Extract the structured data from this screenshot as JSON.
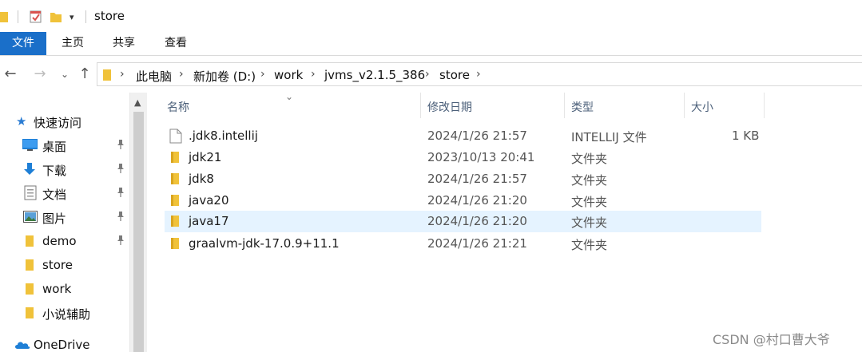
{
  "window": {
    "title": "store"
  },
  "quick_access_toolbar": {
    "icons": [
      "folder-icon",
      "properties-check-icon",
      "new-folder-icon",
      "customize-dropdown-icon"
    ]
  },
  "ribbon": {
    "tabs": [
      "文件",
      "主页",
      "共享",
      "查看"
    ],
    "active": "文件",
    "accent": "#1a6fc9"
  },
  "address_bar": {
    "breadcrumbs": [
      "此电脑",
      "新加卷 (D:)",
      "work",
      "jvms_v2.1.5_386",
      "store"
    ]
  },
  "nav_pane": {
    "quick_access_label": "快速访问",
    "items": [
      {
        "label": "桌面",
        "icon": "desktop-icon",
        "pinned": true
      },
      {
        "label": "下载",
        "icon": "download-icon",
        "pinned": true
      },
      {
        "label": "文档",
        "icon": "documents-icon",
        "pinned": true
      },
      {
        "label": "图片",
        "icon": "pictures-icon",
        "pinned": true
      },
      {
        "label": "demo",
        "icon": "folder-icon",
        "pinned": true
      },
      {
        "label": "store",
        "icon": "folder-icon",
        "pinned": false
      },
      {
        "label": "work",
        "icon": "folder-icon",
        "pinned": false
      },
      {
        "label": "小说辅助",
        "icon": "folder-icon",
        "pinned": false
      }
    ],
    "onedrive_label": "OneDrive"
  },
  "file_list": {
    "columns": {
      "name": "名称",
      "modified": "修改日期",
      "type": "类型",
      "size": "大小"
    },
    "rows": [
      {
        "name": ".jdk8.intellij",
        "modified": "2024/1/26 21:57",
        "type": "INTELLIJ 文件",
        "size": "1 KB",
        "icon": "file-icon",
        "selected": false
      },
      {
        "name": "jdk21",
        "modified": "2023/10/13 20:41",
        "type": "文件夹",
        "size": "",
        "icon": "folder-icon",
        "selected": false
      },
      {
        "name": "jdk8",
        "modified": "2024/1/26 21:57",
        "type": "文件夹",
        "size": "",
        "icon": "folder-icon",
        "selected": false
      },
      {
        "name": "java20",
        "modified": "2024/1/26 21:20",
        "type": "文件夹",
        "size": "",
        "icon": "folder-icon",
        "selected": false
      },
      {
        "name": "java17",
        "modified": "2024/1/26 21:20",
        "type": "文件夹",
        "size": "",
        "icon": "folder-icon",
        "selected": true
      },
      {
        "name": "graalvm-jdk-17.0.9+11.1",
        "modified": "2024/1/26 21:21",
        "type": "文件夹",
        "size": "",
        "icon": "folder-icon",
        "selected": false
      }
    ]
  },
  "watermark": "CSDN @村口曹大爷",
  "colors": {
    "folder": "#f0c23a",
    "folder_dark": "#d9a520",
    "selection": "#e5f3ff",
    "header_text": "#4c607a"
  }
}
